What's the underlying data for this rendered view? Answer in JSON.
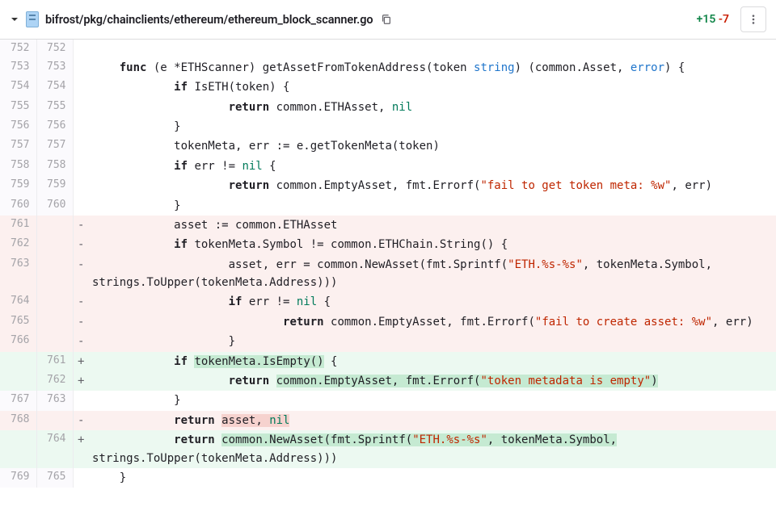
{
  "file": {
    "path": "bifrost/pkg/chainclients/ethereum/ethereum_block_scanner.go",
    "added": "+15",
    "removed": "-7"
  },
  "lines": [
    {
      "o": "752",
      "n": "752",
      "t": "ctx",
      "s": "",
      "c": ""
    },
    {
      "o": "753",
      "n": "753",
      "t": "ctx",
      "s": "",
      "c": "    <span class=\"kw\">func</span> (e *ETHScanner) getAssetFromTokenAddress(token <span class=\"ty\">string</span>) (common.Asset, <span class=\"ty\">error</span>) {"
    },
    {
      "o": "754",
      "n": "754",
      "t": "ctx",
      "s": "",
      "c": "            <span class=\"kw\">if</span> IsETH(token) {"
    },
    {
      "o": "755",
      "n": "755",
      "t": "ctx",
      "s": "",
      "c": "                    <span class=\"kw\">return</span> common.ETHAsset, <span class=\"nl\">nil</span>"
    },
    {
      "o": "756",
      "n": "756",
      "t": "ctx",
      "s": "",
      "c": "            }"
    },
    {
      "o": "757",
      "n": "757",
      "t": "ctx",
      "s": "",
      "c": "            tokenMeta, err := e.getTokenMeta(token)"
    },
    {
      "o": "758",
      "n": "758",
      "t": "ctx",
      "s": "",
      "c": "            <span class=\"kw\">if</span> err != <span class=\"nl\">nil</span> {"
    },
    {
      "o": "759",
      "n": "759",
      "t": "ctx",
      "s": "",
      "c": "                    <span class=\"kw\">return</span> common.EmptyAsset, fmt.Errorf(<span class=\"st\">\"fail to get token meta: %w\"</span>, err)"
    },
    {
      "o": "760",
      "n": "760",
      "t": "ctx",
      "s": "",
      "c": "            }"
    },
    {
      "o": "761",
      "n": "",
      "t": "del",
      "s": "-",
      "c": "            asset := common.ETHAsset"
    },
    {
      "o": "762",
      "n": "",
      "t": "del",
      "s": "-",
      "c": "            <span class=\"kw\">if</span> tokenMeta.Symbol != common.ETHChain.String() {"
    },
    {
      "o": "763",
      "n": "",
      "t": "del",
      "s": "-",
      "c": "                    asset, err = common.NewAsset(fmt.Sprintf(<span class=\"st\">\"ETH.%s-%s\"</span>, tokenMeta.Symbol, strings.ToUpper(tokenMeta.Address)))"
    },
    {
      "o": "764",
      "n": "",
      "t": "del",
      "s": "-",
      "c": "                    <span class=\"kw\">if</span> err != <span class=\"nl\">nil</span> {"
    },
    {
      "o": "765",
      "n": "",
      "t": "del",
      "s": "-",
      "c": "                            <span class=\"kw\">return</span> common.EmptyAsset, fmt.Errorf(<span class=\"st\">\"fail to create asset: %w\"</span>, err)"
    },
    {
      "o": "766",
      "n": "",
      "t": "del",
      "s": "-",
      "c": "                    }"
    },
    {
      "o": "",
      "n": "761",
      "t": "add",
      "s": "+",
      "c": "            <span class=\"kw\">if</span> <span class=\"hl\">tokenMeta.IsEmpty()</span> {"
    },
    {
      "o": "",
      "n": "762",
      "t": "add",
      "s": "+",
      "c": "                    <span class=\"kw\">return</span> <span class=\"hl\">common.EmptyAsset, fmt.Errorf(<span class=\"st\">\"token metadata is empty\"</span>)</span>"
    },
    {
      "o": "767",
      "n": "763",
      "t": "ctx",
      "s": "",
      "c": "            }"
    },
    {
      "o": "768",
      "n": "",
      "t": "del",
      "s": "-",
      "c": "            <span class=\"kw\">return</span> <span class=\"hl\">asset, <span class=\"nl\">nil</span></span>"
    },
    {
      "o": "",
      "n": "764",
      "t": "add",
      "s": "+",
      "c": "            <span class=\"kw\">return</span> <span class=\"hl\">common.NewAsset(fmt.Sprintf(<span class=\"st\">\"ETH.%s-%s\"</span>, tokenMeta.Symbol,</span> strings.ToUpper(tokenMeta.Address)))"
    },
    {
      "o": "769",
      "n": "765",
      "t": "ctx",
      "s": "",
      "c": "    }"
    }
  ]
}
